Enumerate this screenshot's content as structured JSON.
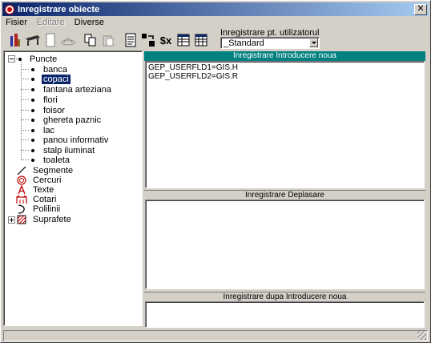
{
  "window": {
    "title": "Inregistrare obiecte",
    "close_glyph": "✕"
  },
  "menu": {
    "items": [
      {
        "label": "Fisier",
        "enabled": true
      },
      {
        "label": "Editare",
        "enabled": false
      },
      {
        "label": "Diverse",
        "enabled": true
      }
    ]
  },
  "toolbar": {
    "icons": [
      "figure-icon",
      "table-icon",
      "page-icon",
      "hat-icon",
      "copy-icon",
      "paste-icon",
      "properties-icon",
      "transfer-icon",
      "variable-icon",
      "grid-icon",
      "grid-edit-icon"
    ],
    "variable_label": "$x"
  },
  "user_registration": {
    "label": "Inregistrare pt. utilizatorul",
    "selected": "_Standard"
  },
  "tree": {
    "root": {
      "label": "Puncte",
      "expanded": true,
      "children": [
        "banca",
        "copaci",
        "fantana arteziana",
        "flori",
        "foisor",
        "ghereta paznic",
        "lac",
        "panou informativ",
        "stalp iluminat",
        "toaleta"
      ],
      "selected_child": "copaci"
    },
    "others": [
      {
        "label": "Segmente",
        "icon": "line-segment-icon"
      },
      {
        "label": "Cercuri",
        "icon": "circle-icon"
      },
      {
        "label": "Texte",
        "icon": "text-A-icon"
      },
      {
        "label": "Cotari",
        "icon": "dimension-icon"
      },
      {
        "label": "Polilinii",
        "icon": "polyline-icon"
      },
      {
        "label": "Suprafete",
        "icon": "surface-icon",
        "collapsed": true
      }
    ]
  },
  "panels": {
    "intro": {
      "header": "Inregistrare Introducere noua",
      "lines": [
        "GEP_USERFLD1=GIS.H",
        "GEP_USERFLD2=GIS.R"
      ]
    },
    "move": {
      "header": "Inregistrare Deplasare"
    },
    "after": {
      "header": "Inregistrare dupa Introducere noua"
    }
  },
  "colors": {
    "title_gradient_start": "#0a246a",
    "title_gradient_end": "#a6caf0",
    "active_header": "#008080",
    "selection": "#0a246a"
  }
}
